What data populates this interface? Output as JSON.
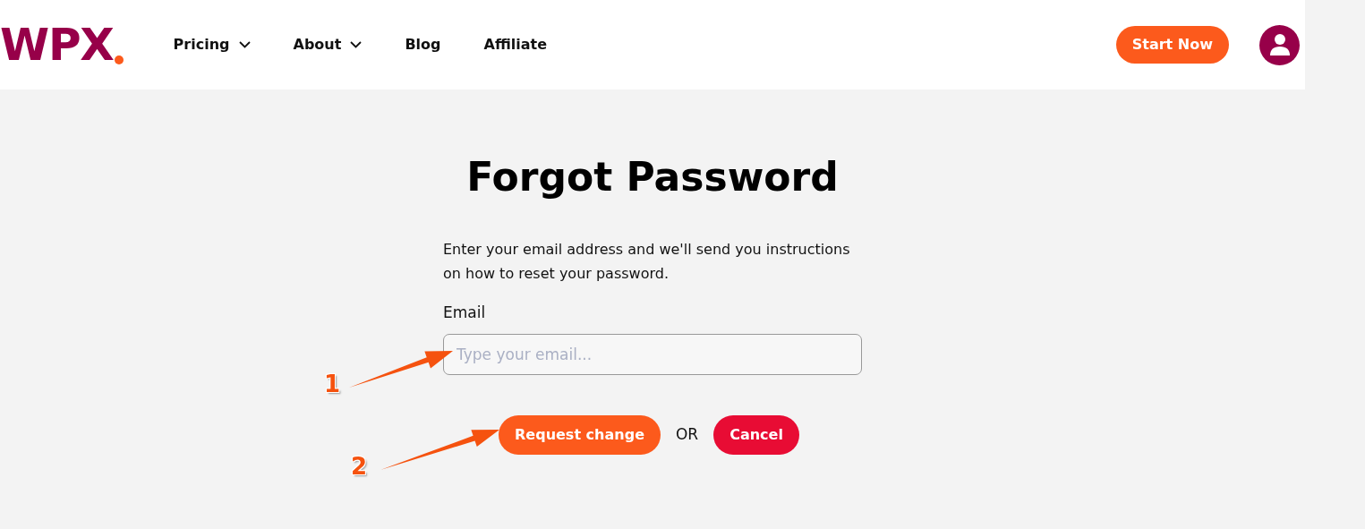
{
  "header": {
    "logo": "WPX",
    "nav": [
      {
        "label": "Pricing",
        "dropdown": true
      },
      {
        "label": "About",
        "dropdown": true
      },
      {
        "label": "Blog",
        "dropdown": false
      },
      {
        "label": "Affiliate",
        "dropdown": false
      }
    ],
    "cta": "Start Now"
  },
  "form": {
    "title": "Forgot Password",
    "intro": "Enter your email address and we'll send you instructions on how to reset your password.",
    "email_label": "Email",
    "email_placeholder": "Type your email...",
    "submit": "Request change",
    "separator": "OR",
    "cancel": "Cancel"
  },
  "annotations": [
    {
      "label": "1"
    },
    {
      "label": "2"
    }
  ]
}
